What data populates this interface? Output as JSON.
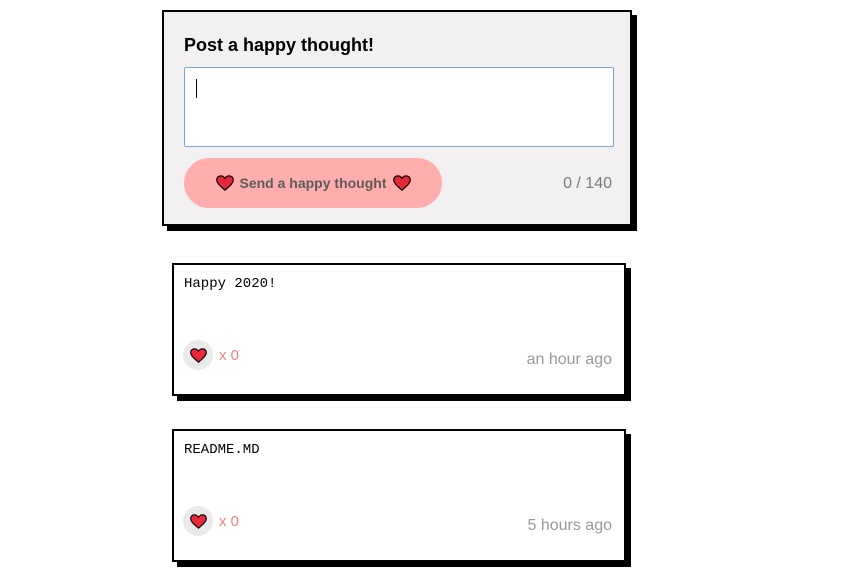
{
  "form": {
    "title": "Post a happy thought!",
    "input_value": "",
    "send_label": "Send a happy thought",
    "counter": "0 / 140"
  },
  "thoughts": [
    {
      "message": "Happy 2020!",
      "likes": "x 0",
      "time": "an hour ago"
    },
    {
      "message": "README.MD",
      "likes": "x 0",
      "time": "5 hours ago"
    }
  ],
  "icons": {
    "heart": "heart-icon"
  },
  "colors": {
    "button_bg": "#ffadad",
    "heart_red": "#e8283a",
    "form_bg": "#f2f0f0",
    "like_count": "#f08080"
  }
}
